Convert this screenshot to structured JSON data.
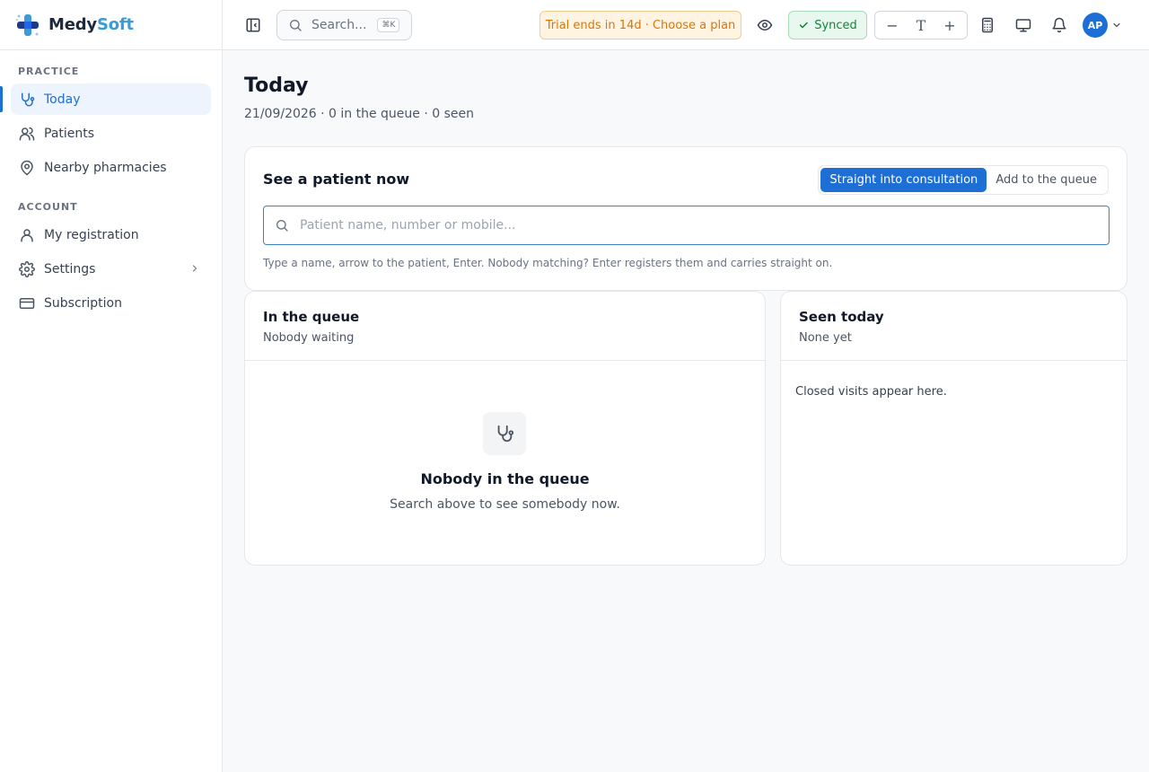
{
  "brand": {
    "name_primary": "Medy",
    "name_accent": "Soft"
  },
  "sidebar": {
    "sections": [
      {
        "title": "PRACTICE",
        "items": [
          {
            "label": "Today",
            "icon": "stethoscope-icon",
            "active": true
          },
          {
            "label": "Patients",
            "icon": "users-icon"
          },
          {
            "label": "Nearby pharmacies",
            "icon": "map-pin-icon"
          }
        ]
      },
      {
        "title": "ACCOUNT",
        "items": [
          {
            "label": "My registration",
            "icon": "user-icon"
          },
          {
            "label": "Settings",
            "icon": "gear-icon",
            "has_submenu": true
          },
          {
            "label": "Subscription",
            "icon": "credit-card-icon"
          }
        ]
      }
    ]
  },
  "header": {
    "search_placeholder": "Search...",
    "search_shortcut": "⌘K",
    "trial_text": "Trial ends in 14d · Choose a plan",
    "sync_status": "Synced",
    "zoom": {
      "decrease": "−",
      "text": "T",
      "increase": "+"
    },
    "avatar_initials": "AP",
    "icons": [
      "sidebar-toggle-icon",
      "search-icon",
      "eye-icon",
      "calculator-icon",
      "monitor-icon",
      "bell-icon",
      "chevron-down-icon"
    ]
  },
  "page": {
    "title": "Today",
    "subtitle": "21/09/2026 · 0 in the queue · 0 seen"
  },
  "see_patient": {
    "title": "See a patient now",
    "mode_options": [
      "Straight into consultation",
      "Add to the queue"
    ],
    "selected_mode": "Straight into consultation",
    "input_placeholder": "Patient name, number or mobile...",
    "input_value": "",
    "hint": "Type a name, arrow to the patient, Enter. Nobody matching? Enter registers them and carries straight on."
  },
  "queue": {
    "title": "In the queue",
    "subtitle": "Nobody waiting",
    "empty_title": "Nobody in the queue",
    "empty_subtitle": "Search above to see somebody now."
  },
  "seen_today": {
    "title": "Seen today",
    "subtitle": "None yet",
    "empty_note": "Closed visits appear here."
  },
  "colors": {
    "accent": "#1d6fd6",
    "brand_accent": "#3b9bd6",
    "trial_text": "#d97706",
    "synced_text": "#15803d"
  }
}
